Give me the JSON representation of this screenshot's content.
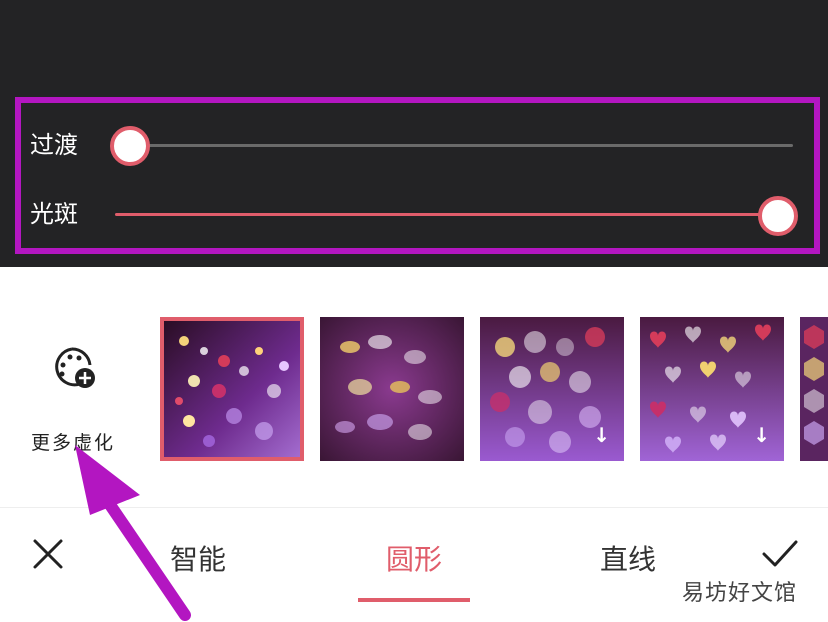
{
  "sliders": [
    {
      "label": "过渡",
      "value": 0.0
    },
    {
      "label": "光斑",
      "value": 1.0
    }
  ],
  "more_button": {
    "label": "更多虚化",
    "icon": "palette-plus-icon"
  },
  "effects": [
    {
      "name": "bokeh-dots",
      "selected": true,
      "downloadable": false
    },
    {
      "name": "bokeh-swirl",
      "selected": false,
      "downloadable": false
    },
    {
      "name": "bokeh-circles",
      "selected": false,
      "downloadable": true
    },
    {
      "name": "bokeh-hearts",
      "selected": false,
      "downloadable": true
    },
    {
      "name": "bokeh-hexagons",
      "selected": false,
      "downloadable": false
    }
  ],
  "tabs": [
    {
      "label": "智能",
      "active": false
    },
    {
      "label": "圆形",
      "active": true
    },
    {
      "label": "直线",
      "active": false
    }
  ],
  "actions": {
    "cancel_icon": "close-icon",
    "confirm_icon": "check-icon"
  },
  "watermark": "易坊好文馆",
  "colors": {
    "accent": "#e05d6b",
    "highlight": "#b316c1",
    "panel": "#232325"
  }
}
